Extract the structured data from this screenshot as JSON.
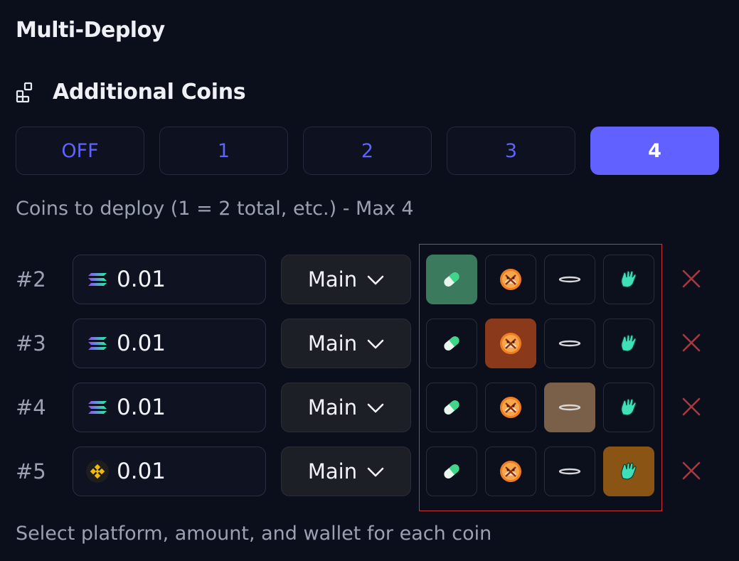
{
  "header": {
    "title": "Multi-Deploy"
  },
  "section": {
    "title": "Additional Coins",
    "icon": "grid-plus-icon"
  },
  "count_options": [
    {
      "label": "OFF",
      "active": false
    },
    {
      "label": "1",
      "active": false
    },
    {
      "label": "2",
      "active": false
    },
    {
      "label": "3",
      "active": false
    },
    {
      "label": "4",
      "active": true
    }
  ],
  "hint": "Coins to deploy (1 = 2 total, etc.) - Max 4",
  "platform_icons": [
    "pill-icon",
    "bonk-dog-icon",
    "ring-halo-icon",
    "waving-hand-icon"
  ],
  "rows": [
    {
      "num": "#2",
      "chain_icon": "solana-icon",
      "amount": "0.01",
      "wallet": "Main",
      "selected_platform": "pill-icon"
    },
    {
      "num": "#3",
      "chain_icon": "solana-icon",
      "amount": "0.01",
      "wallet": "Main",
      "selected_platform": "bonk-dog-icon"
    },
    {
      "num": "#4",
      "chain_icon": "solana-icon",
      "amount": "0.01",
      "wallet": "Main",
      "selected_platform": "ring-halo-icon"
    },
    {
      "num": "#5",
      "chain_icon": "bnb-icon",
      "amount": "0.01",
      "wallet": "Main",
      "selected_platform": "waving-hand-icon"
    }
  ],
  "footer": "Select platform, amount, and wallet for each coin",
  "colors": {
    "background": "#0b0f1c",
    "accent": "#6161ff",
    "pill_selected": "#3b7a5d",
    "bonk_selected": "#8a3a1a",
    "ring_selected": "#7a6048",
    "hand_selected": "#8a5414",
    "remove": "#a8383f",
    "highlight": "#cc3333"
  }
}
